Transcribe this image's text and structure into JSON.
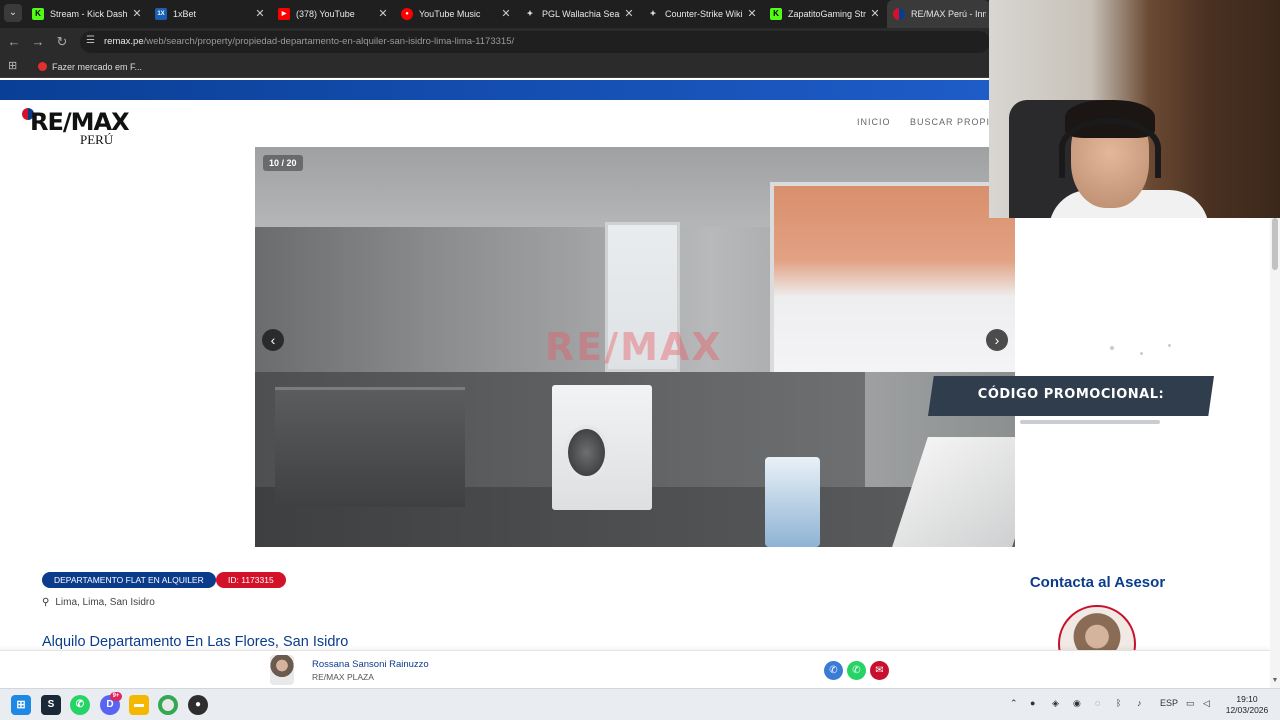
{
  "browser": {
    "tabs": [
      {
        "label": "Stream - Kick Dashboard",
        "icon": "kick-icon",
        "color": "#53fc18",
        "glyph": "K"
      },
      {
        "label": "1xBet",
        "icon": "1xbet-icon",
        "color": "#1a5fb4",
        "glyph": "1X"
      },
      {
        "label": "(378) YouTube",
        "icon": "youtube-icon",
        "color": "#ff0000",
        "glyph": "▶"
      },
      {
        "label": "YouTube Music",
        "icon": "youtube-music-icon",
        "color": "#ff0000",
        "glyph": "●"
      },
      {
        "label": "PGL Wallachia Season",
        "icon": "pgl-icon",
        "color": "#1f1f1f",
        "glyph": "✦"
      },
      {
        "label": "Counter-Strike Wiki |",
        "icon": "liquipedia-icon",
        "color": "#1f1f1f",
        "glyph": "✦"
      },
      {
        "label": "ZapatitoGaming Stre",
        "icon": "kick-icon",
        "color": "#53fc18",
        "glyph": "K"
      },
      {
        "label": "RE/MAX Perú - Inmo",
        "icon": "remax-icon",
        "color": "#d3122a",
        "glyph": "◐"
      }
    ],
    "url_domain": "remax.pe",
    "url_path": "/web/search/property/propiedad-departamento-en-alquiler-san-isidro-lima-lima-1173315/",
    "bookmark": "Fazer mercado em F..."
  },
  "site": {
    "logo_brand": "RE/MAX",
    "logo_sub": "PERÚ",
    "nav": [
      "INICIO",
      "BUSCAR PROPIEDADES"
    ],
    "carousel": {
      "counter": "10 / 20",
      "watermark": "RE/MAX",
      "prev": "‹",
      "next": "›"
    },
    "property": {
      "type_pill": "DEPARTAMENTO FLAT EN ALQUILER",
      "id_pill": "ID: 1173315",
      "location": "Lima, Lima, San Isidro",
      "title": "Alquilo Departamento En Las Flores, San Isidro"
    },
    "contact_title": "Contacta al Asesor",
    "agent": {
      "name": "Rossana Sansoni Rainuzzo",
      "office": "RE/MAX PLAZA"
    }
  },
  "overlay": {
    "promo": "CÓDIGO PROMOCIONAL:"
  },
  "taskbar": {
    "apps": [
      "windows-start",
      "steam",
      "whatsapp",
      "discord",
      "file-explorer",
      "chrome",
      "obs"
    ],
    "discord_badge": "9+",
    "language": "ESP",
    "time": "19:10",
    "date": "12/03/2026"
  },
  "colors": {
    "remax_blue": "#0b3c8c",
    "remax_red": "#d3122a",
    "whatsapp_green": "#25d366"
  }
}
